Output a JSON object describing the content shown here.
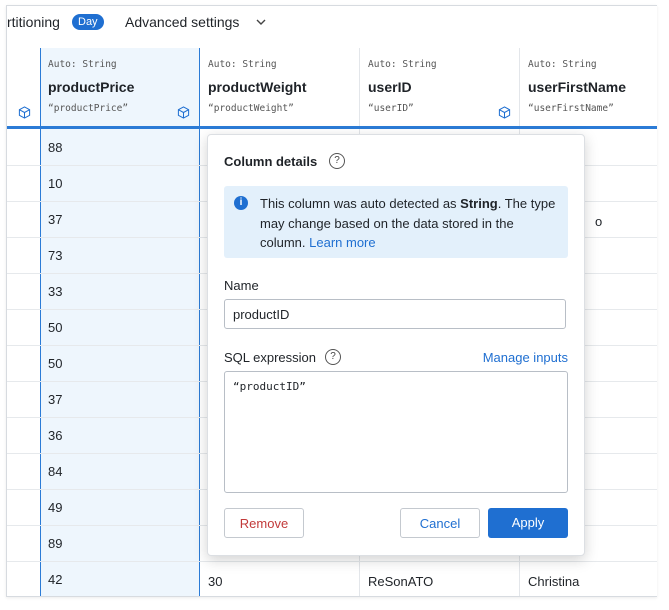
{
  "topbar": {
    "partitioning_label": "rtitioning",
    "partition_badge": "Day",
    "advanced_settings_label": "Advanced settings",
    "chevron_icon": "chevron-down-icon"
  },
  "columns": [
    {
      "type": "Auto: String",
      "name": "productPrice",
      "expr": "“productPrice”"
    },
    {
      "type": "Auto: String",
      "name": "productWeight",
      "expr": "“productWeight”"
    },
    {
      "type": "Auto: String",
      "name": "userID",
      "expr": "“userID”"
    },
    {
      "type": "Auto: String",
      "name": "userFirstName",
      "expr": "“userFirstName”"
    }
  ],
  "rows": {
    "product_price": [
      "88",
      "10",
      "37",
      "73",
      "33",
      "50",
      "50",
      "37",
      "36",
      "84",
      "49",
      "89",
      "42"
    ],
    "last_row": {
      "product_weight": "30",
      "user_id": "ReSonATO",
      "user_first_name": "Christina"
    },
    "partial_cell": "o"
  },
  "popover": {
    "title": "Column details",
    "info": {
      "prefix": "This column was auto detected as ",
      "type": "String",
      "suffix": ". The type may change based on the data stored in the column. ",
      "link": "Learn more"
    },
    "name_label": "Name",
    "name_value": "productID",
    "sql_label": "SQL expression",
    "manage_inputs": "Manage inputs",
    "sql_value": "“productID”",
    "remove_label": "Remove",
    "cancel_label": "Cancel",
    "apply_label": "Apply",
    "help_glyph": "?",
    "info_glyph": "i"
  },
  "colors": {
    "accent": "#1f6fd1",
    "selection": "#eef6fd",
    "danger": "#c23a3a"
  }
}
